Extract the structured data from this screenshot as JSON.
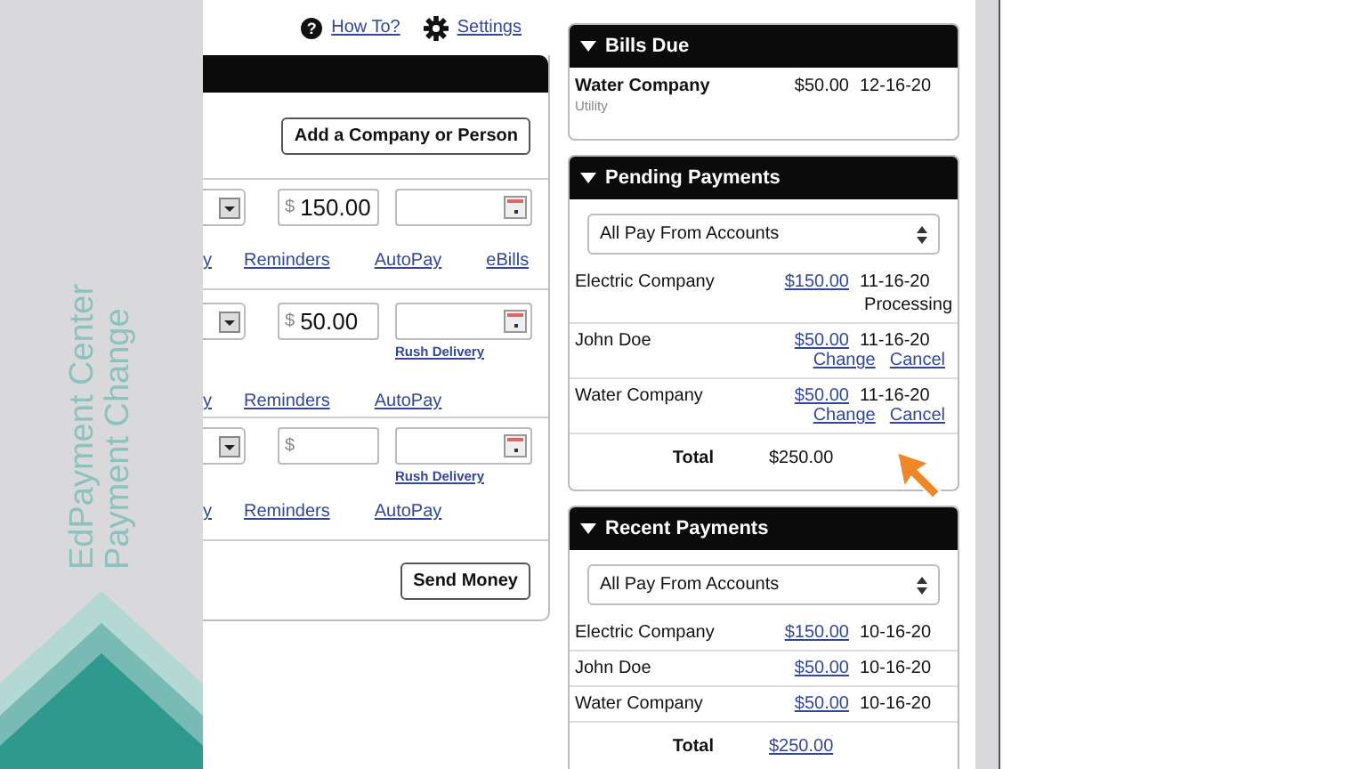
{
  "sidebar": {
    "titles": [
      "EdPayment Center",
      "Payment Change"
    ]
  },
  "header_links": [
    {
      "label": "How To?",
      "kind": "help",
      "icon_text": "?"
    },
    {
      "label": "Settings",
      "kind": "settings"
    }
  ],
  "payment_form": {
    "add_button": "Add a Company or Person",
    "rows": [
      {
        "currency": "$",
        "amount": "150.00",
        "links": [
          "y",
          "Reminders",
          "AutoPay",
          "eBills"
        ]
      },
      {
        "currency": "$",
        "amount": "50.00",
        "rush_delivery": "Rush Delivery",
        "links": [
          "y",
          "Reminders",
          "AutoPay"
        ]
      },
      {
        "currency": "$",
        "rush_delivery": "Rush Delivery",
        "links": [
          "y",
          "Reminders",
          "AutoPay"
        ]
      }
    ],
    "send_button": "Send Money"
  },
  "bills_due": {
    "title": "Bills Due",
    "expanded": true,
    "items": [
      {
        "payee": "Water Company",
        "category": "Utility",
        "amount": "$50.00",
        "date": "12-16-20"
      }
    ]
  },
  "pending_payments": {
    "title": "Pending Payments",
    "expanded": true,
    "account_select": "All Pay From Accounts",
    "items": [
      {
        "payee": "Electric Company",
        "amount": "$150.00",
        "date": "11-16-20",
        "status": "Processing"
      },
      {
        "payee": "John Doe",
        "amount": "$50.00",
        "date": "11-16-20",
        "actions": [
          "Change",
          "Cancel"
        ]
      },
      {
        "payee": "Water Company",
        "amount": "$50.00",
        "date": "11-16-20",
        "actions": [
          "Change",
          "Cancel"
        ]
      }
    ],
    "total_label": "Total",
    "total": "$250.00",
    "total_link": false
  },
  "recent_payments": {
    "title": "Recent Payments",
    "expanded": true,
    "account_select": "All Pay From Accounts",
    "items": [
      {
        "payee": "Electric Company",
        "amount": "$150.00",
        "date": "10-16-20"
      },
      {
        "payee": "John Doe",
        "amount": "$50.00",
        "date": "10-16-20"
      },
      {
        "payee": "Water Company",
        "amount": "$50.00",
        "date": "10-16-20"
      }
    ],
    "total_label": "Total",
    "total": "$250.00",
    "total_link": true
  }
}
